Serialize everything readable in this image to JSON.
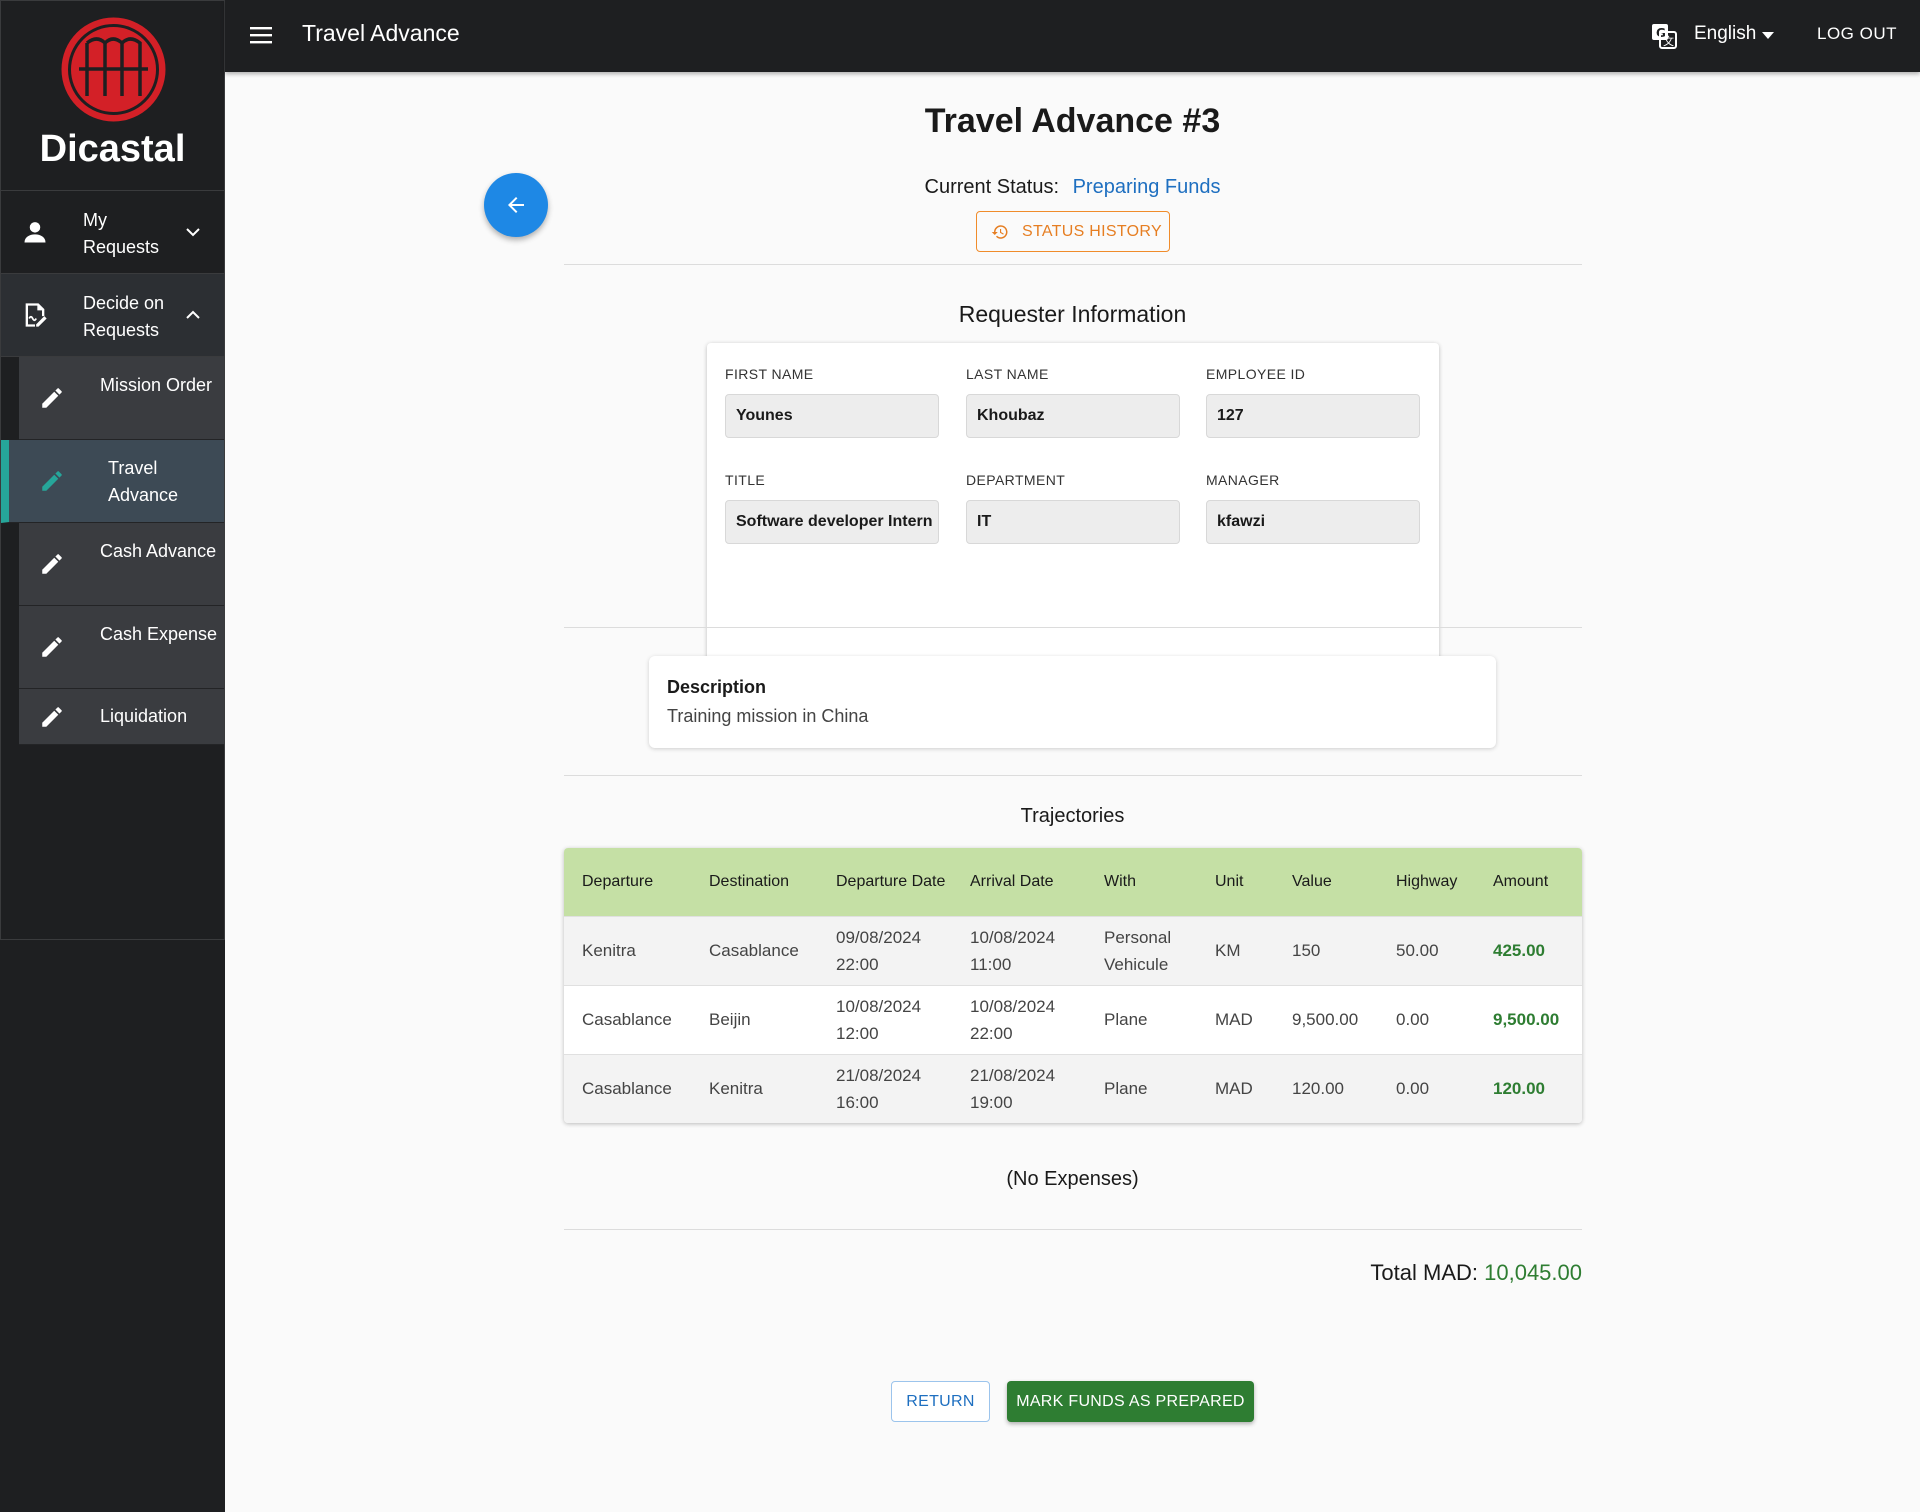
{
  "brand": {
    "name": "Dicastal",
    "logo": "dicastal-logo",
    "logo_color": "#d32027"
  },
  "sidebar": {
    "groups": [
      {
        "label": "My Requests",
        "icon": "person-icon",
        "expanded": false
      },
      {
        "label": "Decide on Requests",
        "icon": "sign-document-icon",
        "expanded": true
      }
    ],
    "items": [
      {
        "label": "Mission Order",
        "icon": "pencil-icon",
        "active": false
      },
      {
        "label": "Travel Advance",
        "icon": "pencil-icon",
        "active": true
      },
      {
        "label": "Cash Advance",
        "icon": "pencil-icon",
        "active": false
      },
      {
        "label": "Cash Expense",
        "icon": "pencil-icon",
        "active": false
      },
      {
        "label": "Liquidation",
        "icon": "pencil-icon",
        "active": false
      }
    ]
  },
  "topbar": {
    "title": "Travel Advance",
    "language": "English",
    "logout": "LOG OUT"
  },
  "page": {
    "title": "Travel Advance #3",
    "status_label": "Current Status:",
    "status_value": "Preparing Funds",
    "status_history": "STATUS HISTORY"
  },
  "requester": {
    "title": "Requester Information",
    "fields": [
      {
        "label": "FIRST NAME",
        "value": "Younes"
      },
      {
        "label": "LAST NAME",
        "value": "Khoubaz"
      },
      {
        "label": "EMPLOYEE ID",
        "value": "127"
      },
      {
        "label": "TITLE",
        "value": "Software developer Intern"
      },
      {
        "label": "DEPARTMENT",
        "value": "IT"
      },
      {
        "label": "MANAGER",
        "value": "kfawzi"
      }
    ]
  },
  "description": {
    "title": "Description",
    "text": "Training mission in China"
  },
  "trajectories": {
    "title": "Trajectories",
    "columns": [
      "Departure",
      "Destination",
      "Departure Date",
      "Arrival Date",
      "With",
      "Unit",
      "Value",
      "Highway",
      "Amount"
    ],
    "rows": [
      [
        "Kenitra",
        "Casablance",
        "09/08/2024 22:00",
        "10/08/2024 11:00",
        "Personal Vehicule",
        "KM",
        "150",
        "50.00",
        "425.00"
      ],
      [
        "Casablance",
        "Beijin",
        "10/08/2024 12:00",
        "10/08/2024 22:00",
        "Plane",
        "MAD",
        "9,500.00",
        "0.00",
        "9,500.00"
      ],
      [
        "Casablance",
        "Kenitra",
        "21/08/2024 16:00",
        "21/08/2024 19:00",
        "Plane",
        "MAD",
        "120.00",
        "0.00",
        "120.00"
      ]
    ]
  },
  "expenses": {
    "empty_text": "(No Expenses)"
  },
  "total": {
    "label": "Total MAD:",
    "value": "10,045.00"
  },
  "actions": {
    "return": "RETURN",
    "prepare": "MARK FUNDS AS PREPARED"
  },
  "colors": {
    "accent_blue": "#1e88e5",
    "success_green": "#2e7d32",
    "table_header": "#c5e0a5",
    "status_history_orange": "#e67e22",
    "active_indicator": "#26a69a"
  }
}
